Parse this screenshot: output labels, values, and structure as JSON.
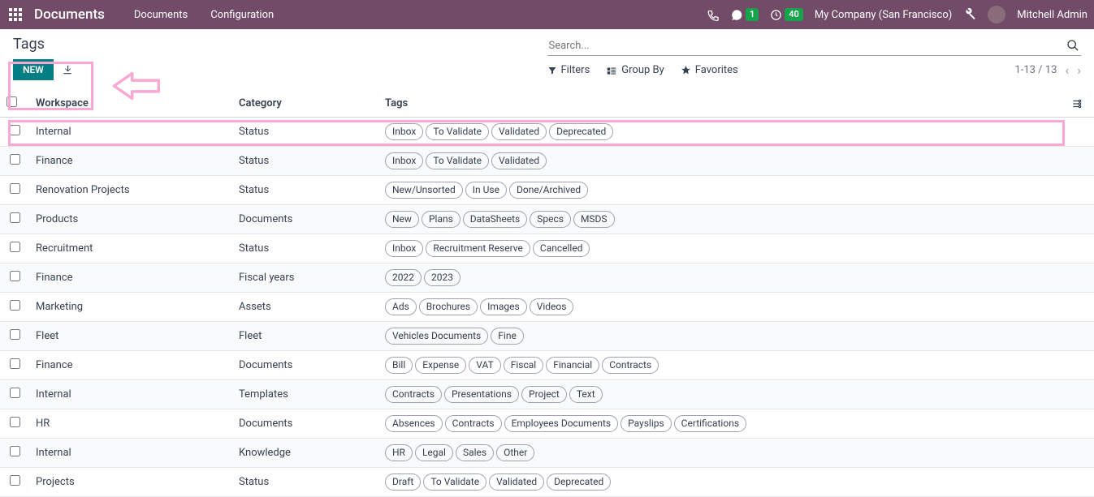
{
  "topbar": {
    "app_title": "Documents",
    "nav": [
      "Documents",
      "Configuration"
    ],
    "msg_badge": "1",
    "clock_badge": "40",
    "company": "My Company (San Francisco)",
    "user": "Mitchell Admin"
  },
  "control": {
    "title": "Tags",
    "new_label": "NEW",
    "search_placeholder": "Search...",
    "filters_label": "Filters",
    "groupby_label": "Group By",
    "favorites_label": "Favorites",
    "pager": "1-13 / 13"
  },
  "columns": {
    "workspace": "Workspace",
    "category": "Category",
    "tags": "Tags"
  },
  "rows": [
    {
      "ws": "Internal",
      "cat": "Status",
      "tags": [
        "Inbox",
        "To Validate",
        "Validated",
        "Deprecated"
      ]
    },
    {
      "ws": "Finance",
      "cat": "Status",
      "tags": [
        "Inbox",
        "To Validate",
        "Validated"
      ]
    },
    {
      "ws": "Renovation Projects",
      "cat": "Status",
      "tags": [
        "New/Unsorted",
        "In Use",
        "Done/Archived"
      ]
    },
    {
      "ws": "Products",
      "cat": "Documents",
      "tags": [
        "New",
        "Plans",
        "DataSheets",
        "Specs",
        "MSDS"
      ]
    },
    {
      "ws": "Recruitment",
      "cat": "Status",
      "tags": [
        "Inbox",
        "Recruitment Reserve",
        "Cancelled"
      ]
    },
    {
      "ws": "Finance",
      "cat": "Fiscal years",
      "tags": [
        "2022",
        "2023"
      ]
    },
    {
      "ws": "Marketing",
      "cat": "Assets",
      "tags": [
        "Ads",
        "Brochures",
        "Images",
        "Videos"
      ]
    },
    {
      "ws": "Fleet",
      "cat": "Fleet",
      "tags": [
        "Vehicles Documents",
        "Fine"
      ]
    },
    {
      "ws": "Finance",
      "cat": "Documents",
      "tags": [
        "Bill",
        "Expense",
        "VAT",
        "Fiscal",
        "Financial",
        "Contracts"
      ]
    },
    {
      "ws": "Internal",
      "cat": "Templates",
      "tags": [
        "Contracts",
        "Presentations",
        "Project",
        "Text"
      ]
    },
    {
      "ws": "HR",
      "cat": "Documents",
      "tags": [
        "Absences",
        "Contracts",
        "Employees Documents",
        "Payslips",
        "Certifications"
      ]
    },
    {
      "ws": "Internal",
      "cat": "Knowledge",
      "tags": [
        "HR",
        "Legal",
        "Sales",
        "Other"
      ]
    },
    {
      "ws": "Projects",
      "cat": "Status",
      "tags": [
        "Draft",
        "To Validate",
        "Validated",
        "Deprecated"
      ]
    }
  ]
}
